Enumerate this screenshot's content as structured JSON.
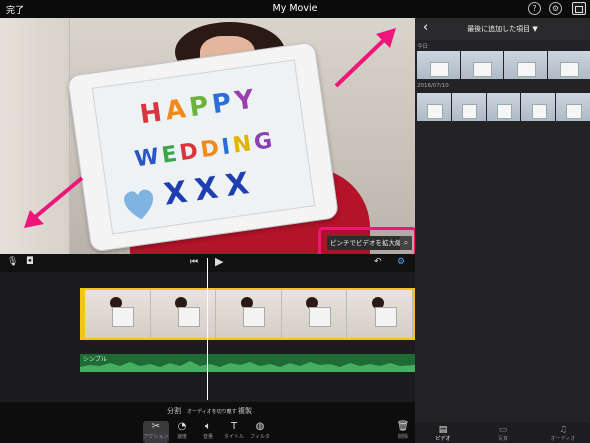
{
  "app": {
    "done_label": "完了",
    "title": "My Movie"
  },
  "header_icons": [
    "help-icon",
    "settings-icon",
    "media-browser-icon"
  ],
  "preview": {
    "sign_lines": [
      "HAPPY",
      "WEDDING",
      "XXX"
    ],
    "tooltip_text": "ピンチでビデオを拡大縮小",
    "accent_color": "#f0157a"
  },
  "controls": {
    "mic_icon": "microphone-icon",
    "camera_icon": "camera-icon",
    "skip_back_icon": "skip-to-start-icon",
    "play_icon": "play-icon",
    "undo_icon": "undo-icon",
    "settings_icon": "project-settings-icon"
  },
  "timeline": {
    "audio_label": "シンプル",
    "clip_border_color": "#f3c615",
    "audio_color": "#1f6b35"
  },
  "edit_actions": {
    "split": "分割",
    "detach_audio": "オーディオを切り離す",
    "duplicate": "複製"
  },
  "toolbar": [
    {
      "icon": "scissors-icon",
      "label": "アクション"
    },
    {
      "icon": "speed-icon",
      "label": "速度"
    },
    {
      "icon": "volume-icon",
      "label": "音量"
    },
    {
      "icon": "title-icon",
      "label": "タイトル"
    },
    {
      "icon": "filter-icon",
      "label": "フィルタ"
    }
  ],
  "delete_label": "削除",
  "panel": {
    "title": "最後に追加した項目 ▼",
    "sections": [
      "今日",
      "2016/07/10"
    ],
    "tabs": [
      {
        "icon": "video-icon",
        "label": "ビデオ"
      },
      {
        "icon": "photo-icon",
        "label": "写真"
      },
      {
        "icon": "audio-icon",
        "label": "オーディオ"
      }
    ]
  }
}
